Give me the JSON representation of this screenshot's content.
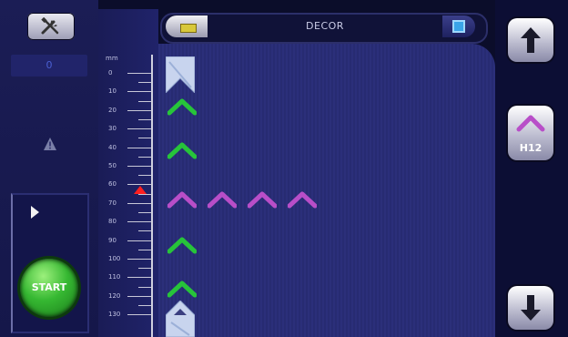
{
  "header": {
    "title": "DECOR"
  },
  "left_panel": {
    "counter_value": "0",
    "start_label": "START"
  },
  "ruler": {
    "unit": "mm",
    "labels": [
      "0",
      "10",
      "20",
      "30",
      "40",
      "50",
      "60",
      "70",
      "80",
      "90",
      "100",
      "110",
      "120",
      "130"
    ],
    "marker_value": 65
  },
  "right_panel": {
    "pattern_label": "H12"
  },
  "icons": {
    "tools": "tools-icon",
    "warning": "warning-icon",
    "play": "play-icon",
    "up": "arrow-up-icon",
    "down": "arrow-down-icon",
    "pattern": "pattern-chevron-icon"
  },
  "colors": {
    "chevron_green": "#27c43a",
    "chevron_purple": "#b84ec8",
    "marker_red": "#ff2020",
    "start_green": "#36b832"
  }
}
